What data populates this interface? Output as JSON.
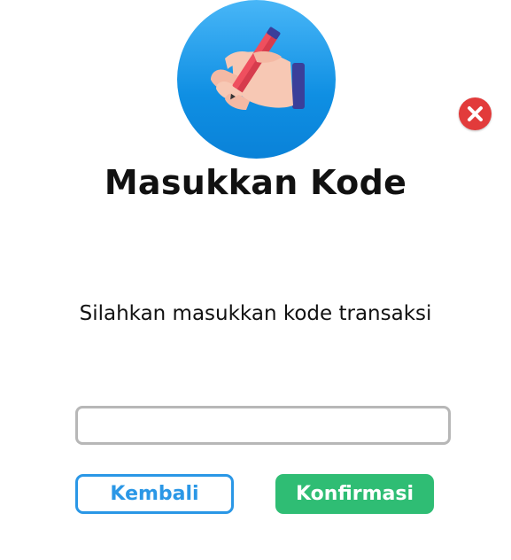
{
  "dialog": {
    "title": "Masukkan Kode",
    "subtitle": "Silahkan masukkan kode transaksi",
    "hero_icon": "hand-writing-pencil-icon",
    "close_icon": "close-icon",
    "code_input": {
      "value": "",
      "placeholder": ""
    },
    "buttons": {
      "back_label": "Kembali",
      "confirm_label": "Konfirmasi"
    }
  },
  "colors": {
    "hero_blue": "#1a9bea",
    "close_red": "#e23b3b",
    "back_blue": "#2a97e6",
    "confirm_green": "#2fbd74"
  }
}
